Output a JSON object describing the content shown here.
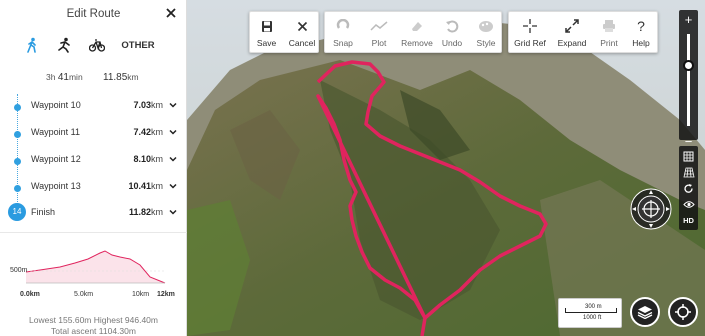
{
  "panel": {
    "title": "Edit Route",
    "modes": {
      "other_label": "OTHER",
      "active": "walk"
    },
    "summary": {
      "time_h": "3h",
      "time_m": "41",
      "time_unit": "min",
      "distance": "11.85",
      "distance_unit": "km"
    },
    "waypoints": [
      {
        "name": "Waypoint 10",
        "distance": "7.03",
        "unit": "km"
      },
      {
        "name": "Waypoint 11",
        "distance": "7.42",
        "unit": "km"
      },
      {
        "name": "Waypoint 12",
        "distance": "8.10",
        "unit": "km"
      },
      {
        "name": "Waypoint 13",
        "distance": "10.41",
        "unit": "km"
      },
      {
        "name": "Finish",
        "number": "14",
        "distance": "11.82",
        "unit": "km"
      }
    ],
    "elevation": {
      "y_tick": "500m",
      "x_ticks": [
        "0.0km",
        "5.0km",
        "10km",
        "12km"
      ],
      "stats_line1": "Lowest 155.60m Highest 946.40m",
      "stats_line2": "Total ascent 1104.30m"
    }
  },
  "toolbar": {
    "save": "Save",
    "cancel": "Cancel",
    "snap": "Snap",
    "plot": "Plot",
    "remove": "Remove",
    "undo": "Undo",
    "style": "Style",
    "grid_ref": "Grid Ref",
    "expand": "Expand",
    "print": "Print",
    "help": "Help"
  },
  "map_controls": {
    "zoom_in": "+",
    "zoom_out": "−",
    "hd_label": "HD",
    "scale_metric": "300 m",
    "scale_imperial": "1000 ft"
  },
  "colors": {
    "route": "#e0245e",
    "accent": "#2a9be0",
    "waypoint_line": "#4aa8e0"
  }
}
